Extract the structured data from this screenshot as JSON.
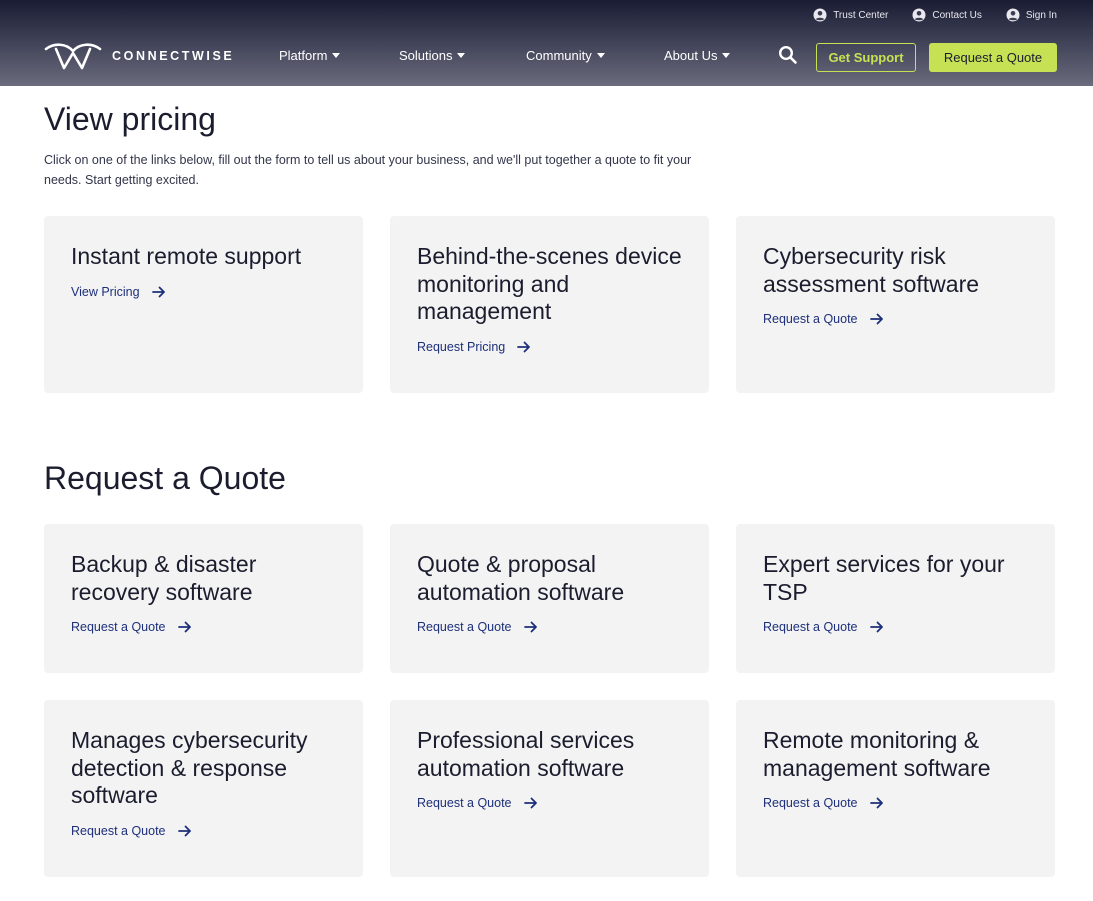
{
  "header": {
    "utility_links": [
      {
        "label": "Trust Center",
        "icon": "user-circle-icon"
      },
      {
        "label": "Contact Us",
        "icon": "user-circle-icon"
      },
      {
        "label": "Sign In",
        "icon": "user-circle-icon"
      }
    ],
    "logo_text": "CONNECTWISE",
    "nav": [
      {
        "label": "Platform"
      },
      {
        "label": "Solutions"
      },
      {
        "label": "Community"
      },
      {
        "label": "About Us"
      }
    ],
    "get_support_label": "Get Support",
    "request_quote_label": "Request a Quote"
  },
  "pricing": {
    "title": "View pricing",
    "intro": "Click on one of the links below, fill out the form to tell us about your business, and we'll put together a quote to fit your needs. Start getting excited.",
    "cards": [
      {
        "title": "Instant remote support",
        "link": "View Pricing"
      },
      {
        "title": "Behind-the-scenes device monitoring and management",
        "link": "Request Pricing"
      },
      {
        "title": "Cybersecurity risk assessment software",
        "link": "Request a Quote"
      }
    ]
  },
  "quote": {
    "title": "Request a Quote",
    "cards": [
      {
        "title": "Backup & disaster recovery software",
        "link": "Request a Quote"
      },
      {
        "title": "Quote & proposal automation software",
        "link": "Request a Quote"
      },
      {
        "title": "Expert services for your TSP",
        "link": "Request a Quote"
      },
      {
        "title": "Manages cybersecurity detection & response software",
        "link": "Request a Quote"
      },
      {
        "title": "Professional services automation software",
        "link": "Request a Quote"
      },
      {
        "title": "Remote monitoring & management software",
        "link": "Request a Quote"
      }
    ]
  },
  "colors": {
    "accent_lime": "#c6e254",
    "link_blue": "#1d2f7a",
    "card_bg": "#f3f3f3",
    "header_dark": "#1a1c33"
  }
}
